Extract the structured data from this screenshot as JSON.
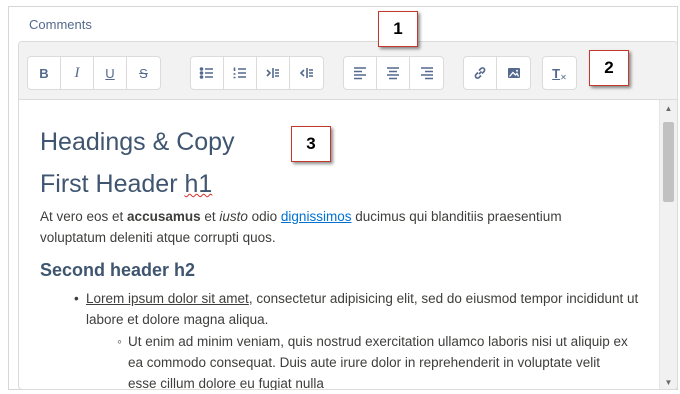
{
  "comments_label": "Comments",
  "toolbar": {
    "bold": "B",
    "italic": "I",
    "underline": "U",
    "strike": "S",
    "clear_format": "T"
  },
  "callouts": [
    "1",
    "2",
    "3"
  ],
  "content": {
    "heading_main": "Headings & Copy",
    "h1_text": "First Header ",
    "h1_suffix": "h1",
    "p1_a": "At vero eos et ",
    "p1_bold": "accusamus",
    "p1_b": " et ",
    "p1_italic": "iusto",
    "p1_c": " odio ",
    "p1_link": "dignissimos",
    "p1_d": " ducimus qui blanditiis praesentium voluptatum deleniti atque corrupti quos.",
    "h2_text": "Second header h2",
    "li1_link": "Lorem ipsum dolor sit amet",
    "li1_rest": ", consectetur adipisicing elit, sed do eiusmod tempor incididunt ut labore et dolore magna aliqua.",
    "li2_text": "Ut enim ad minim veniam, quis nostrud exercitation ullamco laboris nisi ut aliquip ex ea commodo consequat. Duis aute irure dolor in reprehenderit in voluptate velit esse cillum dolore eu fugiat nulla"
  },
  "scrollbar": {
    "up": "▲",
    "down": "▼"
  }
}
